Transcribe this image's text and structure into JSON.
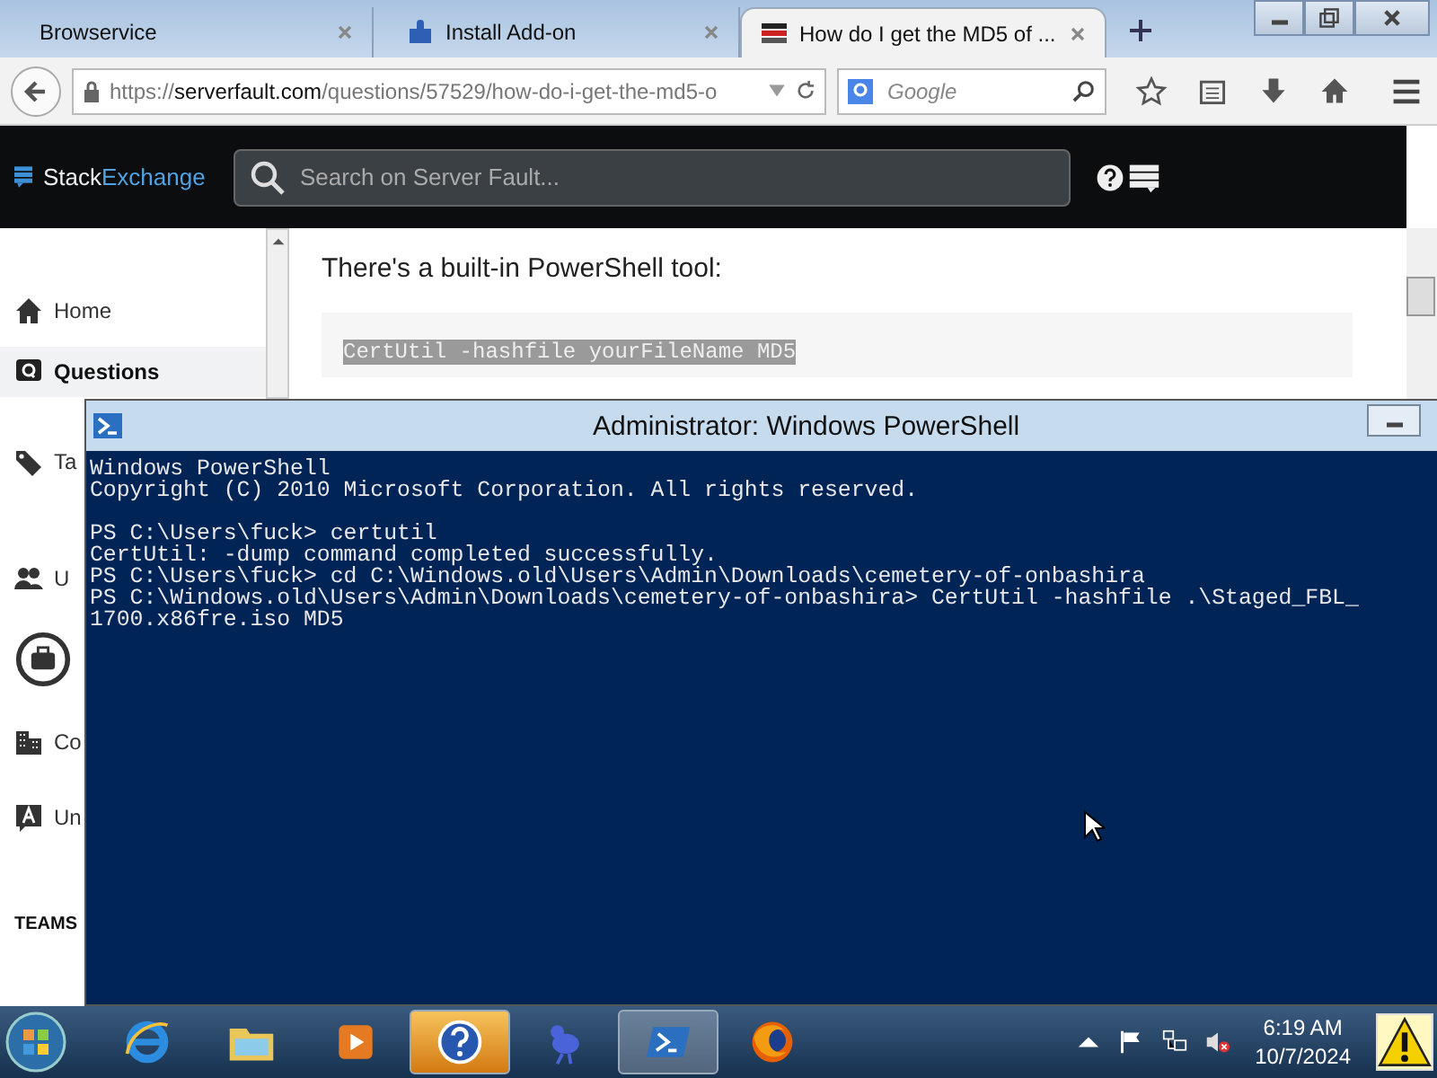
{
  "browser": {
    "tabs": [
      {
        "title": "Browservice",
        "selected": false
      },
      {
        "title": "Install Add-on",
        "selected": false
      },
      {
        "title": "How do I get the MD5 of ...",
        "selected": true
      }
    ],
    "url": {
      "scheme": "https://",
      "host": "serverfault.com",
      "path": "/questions/57529/how-do-i-get-the-md5-o"
    },
    "search_placeholder": "Google"
  },
  "site": {
    "logo": {
      "first": "Stack",
      "second": "Exchange"
    },
    "search_placeholder": "Search on Server Fault...",
    "sidebar": [
      {
        "label": "Home",
        "selected": false
      },
      {
        "label": "Questions",
        "selected": true
      },
      {
        "label": "Ta",
        "selected": false
      },
      {
        "label": "U",
        "selected": false
      },
      {
        "selected": false
      },
      {
        "label": "Co",
        "selected": false
      },
      {
        "label": "Un",
        "selected": false
      }
    ],
    "teams_heading": "TEAMS",
    "intro": "There's a built-in PowerShell tool:",
    "code": {
      "text": "CertUtil -hashfile yourFileName MD5",
      "selected": true
    }
  },
  "powershell": {
    "title": "Administrator: Windows PowerShell",
    "blocks": [
      [
        "Windows PowerShell",
        "Copyright (C) 2010 Microsoft Corporation. All rights reserved."
      ],
      [
        "PS C:\\Users\\fuck> certutil",
        "CertUtil: -dump command completed successfully.",
        "PS C:\\Users\\fuck> cd C:\\Windows.old\\Users\\Admin\\Downloads\\cemetery-of-onbashira",
        "PS C:\\Windows.old\\Users\\Admin\\Downloads\\cemetery-of-onbashira> CertUtil -hashfile .\\Staged_FBL_",
        "1700.x86fre.iso MD5"
      ]
    ]
  },
  "taskbar": {
    "apps": [
      {
        "selected": false
      },
      {
        "selected": false
      },
      {
        "selected": false
      },
      {
        "selected": true
      },
      {
        "selected": false
      },
      {
        "selected": true
      },
      {
        "selected": false
      }
    ],
    "time": "6:19 AM",
    "date": "10/7/2024",
    "speaker_muted": true
  }
}
